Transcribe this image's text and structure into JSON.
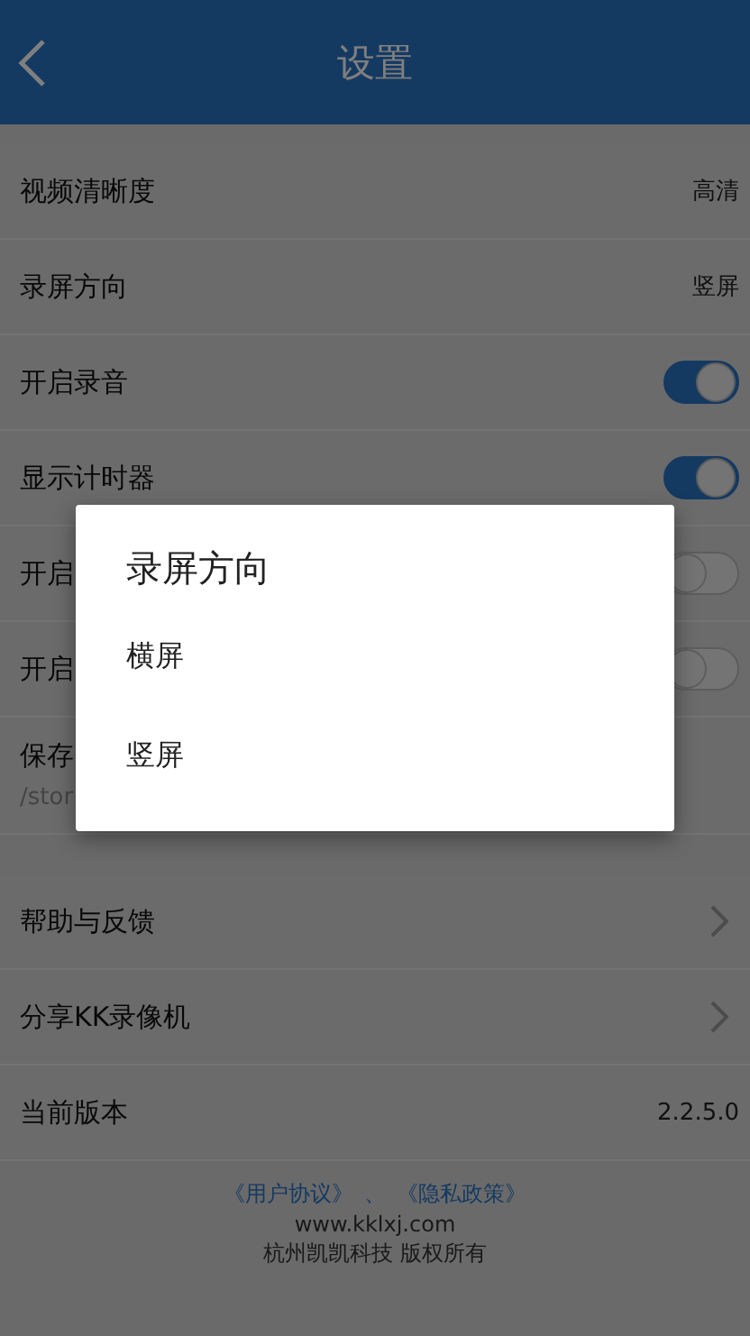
{
  "header": {
    "title": "设置"
  },
  "groups": [
    {
      "items": [
        {
          "kind": "value",
          "label": "视频清晰度",
          "value": "高清"
        },
        {
          "kind": "value",
          "label": "录屏方向",
          "value": "竖屏"
        },
        {
          "kind": "toggle",
          "label": "开启录音",
          "on": true
        },
        {
          "kind": "toggle",
          "label": "显示计时器",
          "on": true
        },
        {
          "kind": "toggle",
          "label": "开启",
          "on": false
        },
        {
          "kind": "toggle",
          "label": "开启",
          "on": false
        },
        {
          "kind": "path",
          "label": "保存",
          "path": "/stor"
        }
      ]
    },
    {
      "items": [
        {
          "kind": "link",
          "label": "帮助与反馈"
        },
        {
          "kind": "link",
          "label": "分享KK录像机"
        },
        {
          "kind": "value",
          "label": "当前版本",
          "value": "2.2.5.0"
        }
      ]
    }
  ],
  "footer": {
    "links": [
      "《用户协议》",
      "《隐私政策》"
    ],
    "separator": "、",
    "website": "www.kklxj.com",
    "copyright": "杭州凯凯科技 版权所有"
  },
  "dialog": {
    "title": "录屏方向",
    "options": [
      {
        "label": "横屏"
      },
      {
        "label": "竖屏"
      }
    ]
  }
}
